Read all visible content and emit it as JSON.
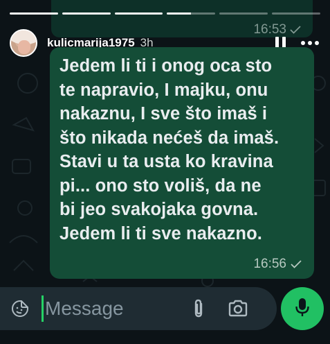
{
  "story": {
    "username": "kulicmarija1975",
    "time_ago": "3h",
    "progress": [
      1,
      1,
      1,
      0.5,
      0,
      0
    ]
  },
  "previous_message": {
    "time": "16:53"
  },
  "message": {
    "text": "Jedem li ti i onog oca sto\nte napravio, I majku, onu\nnakaznu, I sve što imaš i\nšto nikada nećeš da imaš.\nStavi u ta usta ko kravina\npi... ono sto voliš,  da ne\nbi jeo svakojaka govna.\nJedem li ti sve nakazno.",
    "time": "16:56",
    "status_icon": "single-check-icon"
  },
  "composer": {
    "placeholder": "Message",
    "value": ""
  },
  "colors": {
    "bubble": "#144d37",
    "accent": "#21c063",
    "input_bar": "#1f2c33",
    "background": "#0c1317"
  }
}
